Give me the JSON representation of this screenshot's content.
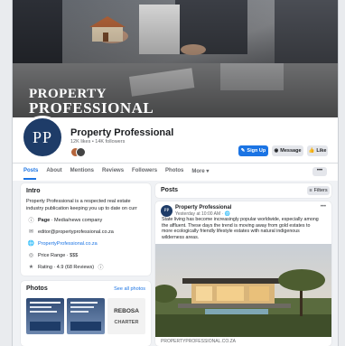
{
  "page": {
    "name": "Property Professional",
    "stats": "12K likes • 14K followers",
    "profile_initials": "PP"
  },
  "cover": {
    "title_line1": "PROPERTY",
    "title_line2": "PROFESSIONAL"
  },
  "actions": {
    "sign_up": "Sign Up",
    "message": "Message",
    "like": "Like",
    "more": "•••"
  },
  "tabs": [
    "Posts",
    "About",
    "Mentions",
    "Reviews",
    "Followers",
    "Photos",
    "More"
  ],
  "intro": {
    "heading": "Intro",
    "text_line1": "Property Professional is a respected real estate",
    "text_line2": "industry publication keeping you up to date on curr",
    "category_label": "Page",
    "category": " · Media/news company",
    "email": "editor@propertyprofessional.co.za",
    "website": "PropertyProfessional.co.za",
    "price_range": "Price Range · $$$",
    "rating": "Rating · 4.9 (68 Reviews)"
  },
  "photos": {
    "heading": "Photos",
    "see_all": "See all photos",
    "thumb3_line1": "REBOSA",
    "thumb3_line2": "CHARTER"
  },
  "posts": {
    "heading": "Posts",
    "filters": "Filters",
    "author": "Property Professional",
    "time": "Yesterday at 10:00 AM · ",
    "text": "State living has become increasingly popular worldwide, especially among the affluent. These days the trend is moving away from gold estates to more ecologically friendly lifestyle estates with natural indigenous wilderness areas.",
    "link_domain": "PROPERTYPROFESSIONAL.CO.ZA",
    "menu": "•••"
  },
  "colors": {
    "accent": "#1b74e4",
    "brand_navy": "#1e3c68"
  }
}
